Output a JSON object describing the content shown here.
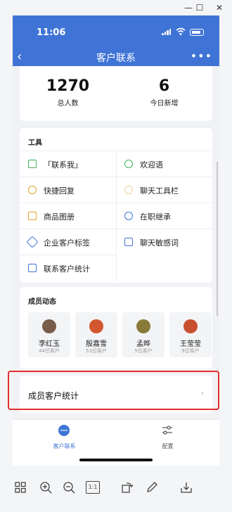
{
  "status": {
    "time": "11:06"
  },
  "nav": {
    "title": "客户联系"
  },
  "stats": [
    {
      "value": "1270",
      "label": "总人数"
    },
    {
      "value": "6",
      "label": "今日新增"
    }
  ],
  "tools": {
    "title": "工具",
    "items": [
      {
        "label": "「联系我」",
        "icon": "qr-chat-icon",
        "color": "#3fb25d"
      },
      {
        "label": "欢迎语",
        "icon": "hi-bubble-icon",
        "color": "#3fb25d"
      },
      {
        "label": "快捷回复",
        "icon": "quick-reply-icon",
        "color": "#e0a32b"
      },
      {
        "label": "聊天工具栏",
        "icon": "toolbar-icon",
        "color": "#e0a32b"
      },
      {
        "label": "商品图册",
        "icon": "catalog-icon",
        "color": "#e0a32b"
      },
      {
        "label": "在职继承",
        "icon": "transfer-icon",
        "color": "#3f74d6"
      },
      {
        "label": "企业客户标签",
        "icon": "tag-icon",
        "color": "#3f74d6"
      },
      {
        "label": "聊天敏感词",
        "icon": "sensitive-word-icon",
        "color": "#3f74d6"
      },
      {
        "label": "联系客户统计",
        "icon": "stats-chart-icon",
        "color": "#3f74d6"
      }
    ]
  },
  "members": {
    "title": "成员动态",
    "items": [
      {
        "name": "李红玉",
        "count": "44位客户",
        "avatar_color": "#7a5c4a"
      },
      {
        "name": "殷嘉雪",
        "count": "53位客户",
        "avatar_color": "#d2562f"
      },
      {
        "name": "孟晔",
        "count": "5位客户",
        "avatar_color": "#8a7a3a"
      },
      {
        "name": "王莹莹",
        "count": "9位客户",
        "avatar_color": "#c8502f"
      }
    ]
  },
  "member_stats": {
    "label": "成员客户统计",
    "arrow": "›"
  },
  "tabbar": {
    "tabs": [
      {
        "label": "客户联系",
        "active": true,
        "color": "#3f74d6"
      },
      {
        "label": "配置",
        "active": false,
        "color": "#555555"
      }
    ]
  },
  "toolbar": {
    "items": [
      "grid-icon",
      "zoom-in-icon",
      "zoom-out-icon",
      "actual-size-icon",
      "rotate-icon",
      "edit-icon",
      "download-icon"
    ],
    "actual_size_label": "1:1"
  },
  "window": {
    "minimize": "—",
    "maximize": "☐",
    "close": "✕"
  }
}
